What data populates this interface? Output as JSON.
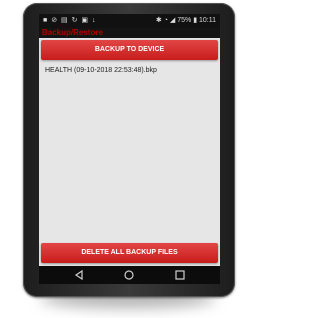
{
  "status_bar": {
    "left_icons": [
      "android-icon",
      "no-sim-icon",
      "data-icon",
      "sync-icon",
      "image-icon",
      "download-icon"
    ],
    "right_icons": [
      "bluetooth-icon",
      "wifi-icon",
      "signal-icon"
    ],
    "battery": "75%",
    "time": "10:11"
  },
  "app": {
    "title": "Backup/Restore",
    "accent_color": "#d32f2f"
  },
  "buttons": {
    "backup_label": "BACKUP TO DEVICE",
    "delete_label": "DELETE ALL BACKUP FILES"
  },
  "backup_files": [
    "HEALTH (09-10-2018  22:53:48).bkp"
  ],
  "nav_bar": {
    "icons": [
      "back-icon",
      "home-icon",
      "recents-icon"
    ]
  }
}
